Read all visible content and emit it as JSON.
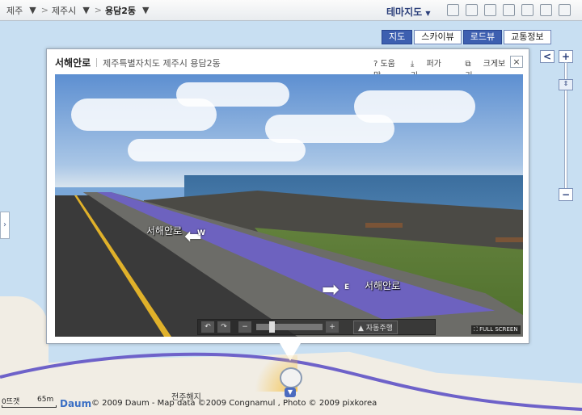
{
  "breadcrumb": {
    "items": [
      {
        "label": "제주"
      },
      {
        "label": "제주시"
      },
      {
        "label": "용담2동"
      }
    ]
  },
  "toolbar": {
    "theme_label": "테마지도",
    "icons": [
      "save-icon",
      "disk-icon",
      "mail-icon",
      "print-icon",
      "ruler-icon",
      "expand-icon",
      "refresh-icon"
    ]
  },
  "view_buttons": [
    {
      "label": "지도",
      "active": true
    },
    {
      "label": "스카이뷰",
      "active": false
    },
    {
      "label": "로드뷰",
      "active": true
    },
    {
      "label": "교통정보",
      "active": false
    }
  ],
  "popup": {
    "title": "서해안로",
    "address": "제주특별자치도 제주시 용담2동",
    "links": {
      "help": "? 도움말",
      "share": "퍼가기",
      "enlarge": "크게보기"
    },
    "close": "×",
    "road_labels": {
      "left": "서해안로",
      "right": "서해안로"
    },
    "directions": {
      "west": "W",
      "east": "E"
    },
    "controls": {
      "auto_drive": "자동주행"
    },
    "fullscreen": "FULL SCREEN"
  },
  "zoom": {
    "in": "+",
    "out": "−",
    "left": "<"
  },
  "footer": {
    "scale_left": "0뜨갯",
    "scale_right": "65m",
    "logo": "Daum",
    "copyright": "© 2009 Daum - Map data ©2009 Congnamul , Photo © 2009 pixkorea",
    "place_label": "전주해지"
  },
  "colors": {
    "accent": "#3d5fb0",
    "roadview_line": "#6e62c9"
  }
}
